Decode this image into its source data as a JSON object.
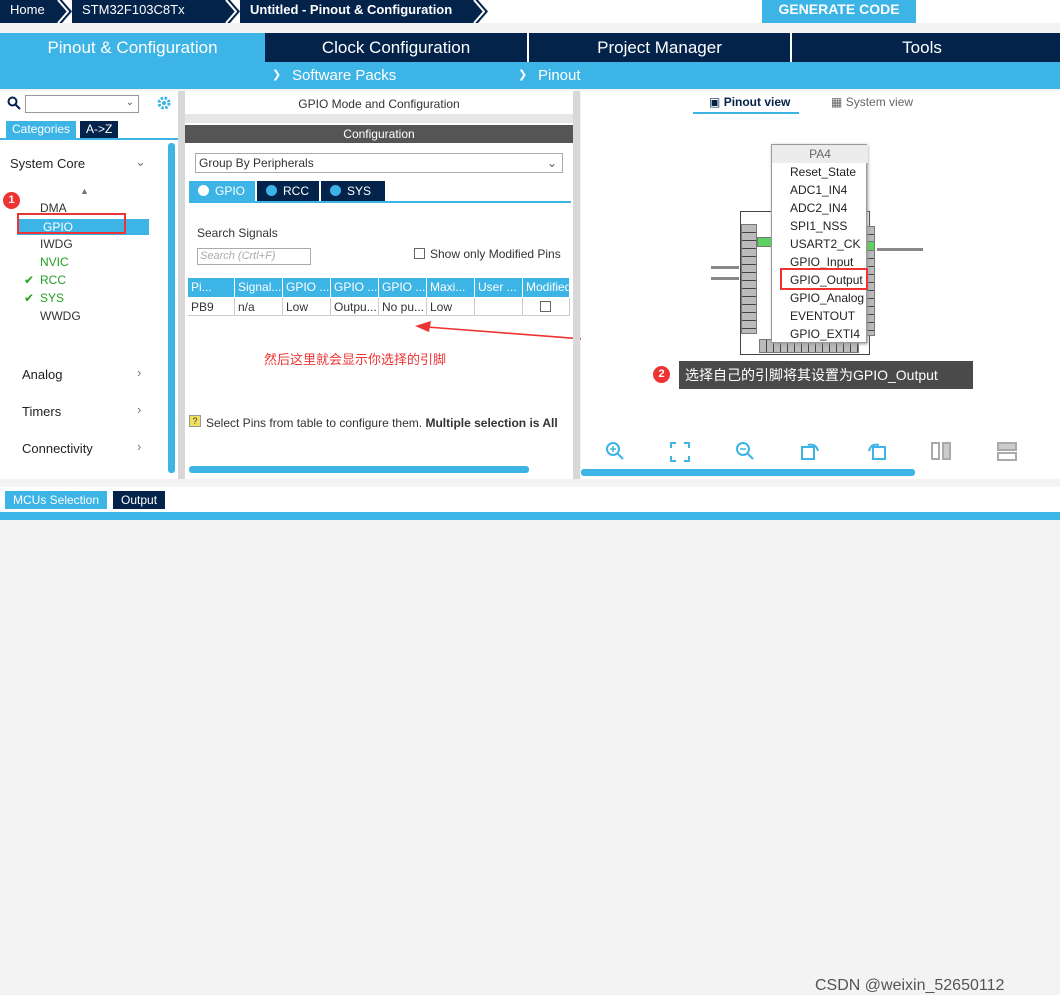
{
  "breadcrumb": {
    "items": [
      "Home",
      "STM32F103C8Tx",
      "Untitled - Pinout & Configuration"
    ],
    "generate_label": "GENERATE CODE"
  },
  "main_tabs": [
    "Pinout & Configuration",
    "Clock Configuration",
    "Project Manager",
    "Tools"
  ],
  "sub_tabs": [
    "Software Packs",
    "Pinout"
  ],
  "left": {
    "category_tabs": [
      "Categories",
      "A->Z"
    ],
    "system_core": "System Core",
    "items": [
      "DMA",
      "GPIO",
      "IWDG",
      "NVIC",
      "RCC",
      "SYS",
      "WWDG"
    ],
    "sections": [
      "Analog",
      "Timers",
      "Connectivity"
    ]
  },
  "middle": {
    "mode_title": "GPIO Mode and Configuration",
    "config_title": "Configuration",
    "group_by": "Group By Peripherals",
    "peripheral_tabs": [
      "GPIO",
      "RCC",
      "SYS"
    ],
    "search_label": "Search Signals",
    "search_placeholder": "Search (Crtl+F)",
    "show_modified": "Show only Modified Pins",
    "columns": [
      "Pi...",
      "Signal...",
      "GPIO ...",
      "GPIO ...",
      "GPIO ...",
      "Maxi...",
      "User ...",
      "Modified"
    ],
    "row": [
      "PB9",
      "n/a",
      "Low",
      "Outpu...",
      "No pu...",
      "Low",
      "",
      ""
    ],
    "hint": "Select Pins from table to configure them.",
    "hint_bold": "Multiple selection is All",
    "annotation": "然后这里就会显示你选择的引脚"
  },
  "right": {
    "view_tabs": [
      "Pinout view",
      "System view"
    ],
    "menu_title": "PA4",
    "menu_items": [
      "Reset_State",
      "ADC1_IN4",
      "ADC2_IN4",
      "SPI1_NSS",
      "USART2_CK",
      "GPIO_Input",
      "GPIO_Output",
      "GPIO_Analog",
      "EVENTOUT",
      "GPIO_EXTI4"
    ],
    "tooltip": "选择自己的引脚将其设置为GPIO_Output"
  },
  "bottom": {
    "tabs": [
      "MCUs Selection",
      "Output"
    ],
    "watermark": "CSDN @weixin_52650112"
  },
  "badges": [
    "1",
    "2"
  ],
  "colors": {
    "accent": "#3cb4e6",
    "navy": "#03234b",
    "callout": "#e33333"
  }
}
